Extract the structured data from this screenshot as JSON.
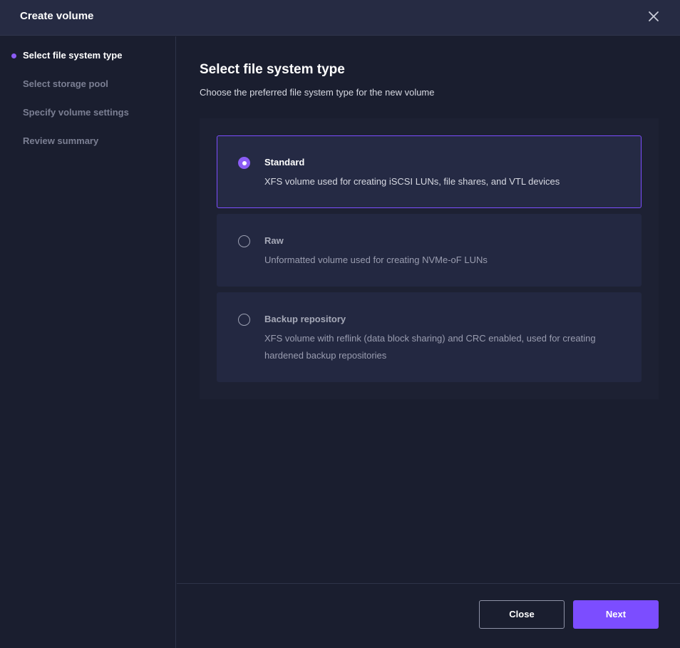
{
  "dialog": {
    "title": "Create volume",
    "close_icon": "close-icon"
  },
  "steps": [
    {
      "label": "Select file system type",
      "active": true
    },
    {
      "label": "Select storage pool",
      "active": false
    },
    {
      "label": "Specify volume settings",
      "active": false
    },
    {
      "label": "Review summary",
      "active": false
    }
  ],
  "main": {
    "title": "Select file system type",
    "subtitle": "Choose the preferred file system type for the new volume"
  },
  "options": [
    {
      "title": "Standard",
      "description": "XFS volume used for creating iSCSI LUNs, file shares, and VTL devices",
      "selected": true
    },
    {
      "title": "Raw",
      "description": "Unformatted volume used for creating NVMe-oF LUNs",
      "selected": false
    },
    {
      "title": "Backup repository",
      "description": "XFS volume with reflink (data block sharing) and CRC enabled, used for creating hardened backup repositories",
      "selected": false
    }
  ],
  "footer": {
    "close_label": "Close",
    "next_label": "Next"
  },
  "colors": {
    "accent": "#7c4dff",
    "background": "#1a1e2f",
    "header": "#262b43"
  }
}
